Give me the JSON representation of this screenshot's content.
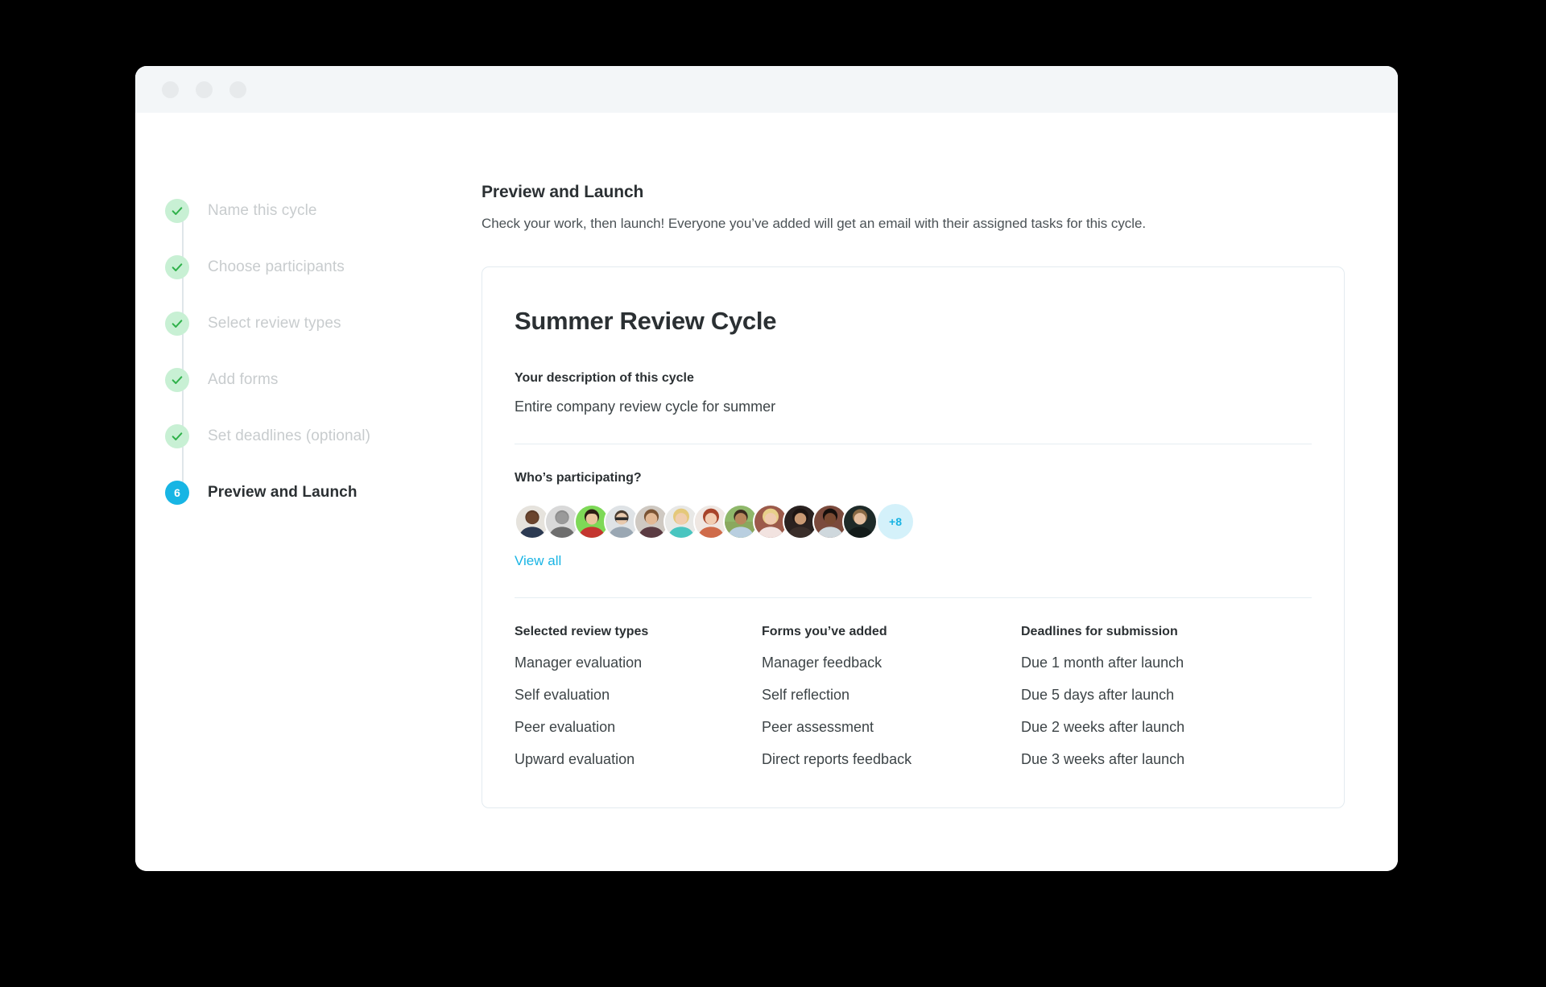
{
  "window": {
    "traffic_lights": [
      "close",
      "minimize",
      "maximize"
    ]
  },
  "stepper": {
    "steps": [
      {
        "label": "Name this cycle",
        "state": "done",
        "marker": "check"
      },
      {
        "label": "Choose participants",
        "state": "done",
        "marker": "check"
      },
      {
        "label": "Select review types",
        "state": "done",
        "marker": "check"
      },
      {
        "label": "Add forms",
        "state": "done",
        "marker": "check"
      },
      {
        "label": "Set deadlines (optional)",
        "state": "done",
        "marker": "check"
      },
      {
        "label": "Preview and Launch",
        "state": "current",
        "marker": "6"
      }
    ]
  },
  "header": {
    "title": "Preview and Launch",
    "subtitle": "Check your work, then launch! Everyone you’ve added will get an email with their assigned tasks for this cycle."
  },
  "card": {
    "title": "Summer Review Cycle",
    "description": {
      "label": "Your description of this cycle",
      "value": "Entire company review cycle for summer"
    },
    "participants": {
      "label": "Who’s participating?",
      "more_count": "+8",
      "view_all_label": "View all",
      "avatar_count": 12
    },
    "columns": [
      {
        "heading": "Selected review types",
        "items": [
          "Manager evaluation",
          "Self evaluation",
          "Peer evaluation",
          "Upward evaluation"
        ]
      },
      {
        "heading": "Forms you’ve added",
        "items": [
          "Manager feedback",
          "Self reflection",
          "Peer assessment",
          "Direct reports feedback"
        ]
      },
      {
        "heading": "Deadlines for submission",
        "items": [
          "Due 1 month after launch",
          "Due 5 days after launch",
          "Due 2 weeks after launch",
          "Due 3 weeks after launch"
        ]
      }
    ]
  },
  "colors": {
    "accent": "#18b5e4",
    "accent_soft": "#d4f1fa",
    "done_badge": "#c8f0d4",
    "check": "#2fb14a",
    "titlebar": "#f3f6f8",
    "card_border": "#e3ebf0",
    "muted_text": "#c8ccce",
    "body_text": "#3d4447"
  }
}
